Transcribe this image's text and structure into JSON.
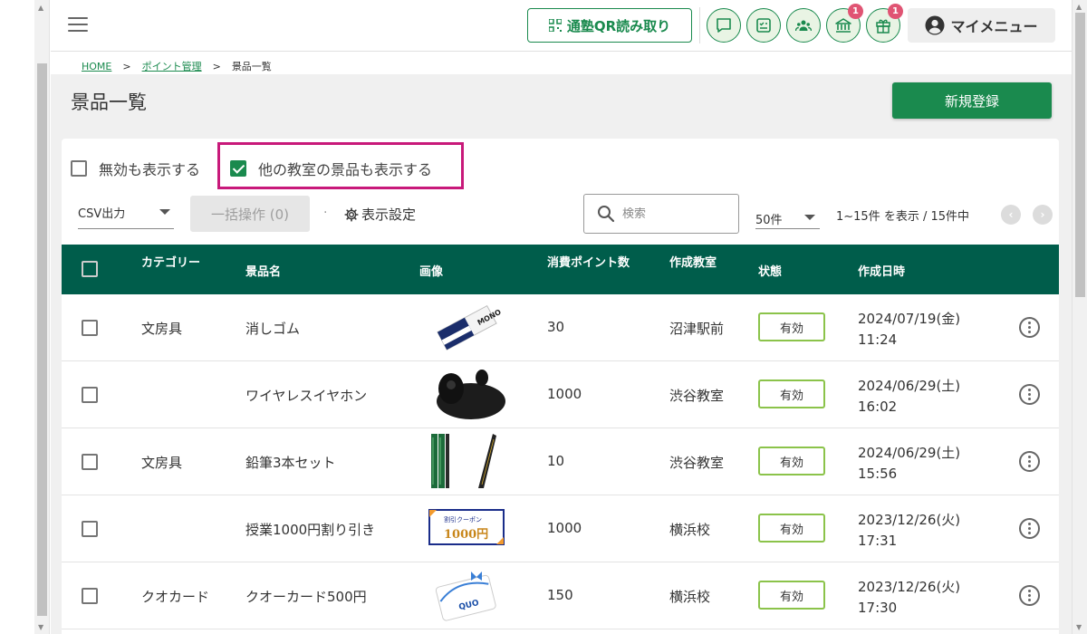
{
  "header": {
    "qr_label": "通塾QR読み取り",
    "badges": {
      "bank": "1",
      "gift": "1"
    },
    "my_menu_label": "マイメニュー"
  },
  "breadcrumb": {
    "home": "HOME",
    "sep": ">",
    "points": "ポイント管理",
    "current": "景品一覧"
  },
  "page": {
    "title": "景品一覧",
    "new_button": "新規登録"
  },
  "filters": {
    "show_invalid": {
      "label": "無効も表示する",
      "checked": false
    },
    "show_other_class": {
      "label": "他の教室の景品も表示する",
      "checked": true
    }
  },
  "toolbar": {
    "csv_label": "CSV出力",
    "bulk_label": "一括操作 (0)",
    "dot": "·",
    "display_settings": "表示設定",
    "search_placeholder": "検索",
    "per_page": "50件",
    "range": "1~15件 を表示 / 15件中"
  },
  "table": {
    "headers": {
      "category": "カテゴリー",
      "name": "景品名",
      "image": "画像",
      "points": "消費ポイント数",
      "classroom": "作成教室",
      "status": "状態",
      "created": "作成日時"
    },
    "rows": [
      {
        "category": "文房具",
        "name": "消しゴム",
        "image": "eraser",
        "points": "30",
        "classroom": "沼津駅前",
        "status": "有効",
        "date": "2024/07/19(金)",
        "time": "11:24"
      },
      {
        "category": "",
        "name": "ワイヤレスイヤホン",
        "image": "earbuds",
        "points": "1000",
        "classroom": "渋谷教室",
        "status": "有効",
        "date": "2024/06/29(土)",
        "time": "16:02"
      },
      {
        "category": "文房具",
        "name": "鉛筆3本セット",
        "image": "pencils",
        "points": "10",
        "classroom": "渋谷教室",
        "status": "有効",
        "date": "2024/06/29(土)",
        "time": "15:56"
      },
      {
        "category": "",
        "name": "授業1000円割り引き",
        "image": "coupon",
        "points": "1000",
        "classroom": "横浜校",
        "status": "有効",
        "date": "2023/12/26(火)",
        "time": "17:31"
      },
      {
        "category": "クオカード",
        "name": "クオーカード500円",
        "image": "quocard",
        "points": "150",
        "classroom": "横浜校",
        "status": "有効",
        "date": "2023/12/26(火)",
        "time": "17:30"
      }
    ]
  },
  "images": {
    "eraser_text": "MONO",
    "coupon_top": "割引クーポン",
    "coupon_value": "1000円",
    "quocard_text": "QUO"
  },
  "colors": {
    "primary": "#1a8a4e",
    "table_header": "#005d4b",
    "highlight": "#c8197a",
    "badge": "#e05473",
    "status_border": "#8bc34a"
  }
}
